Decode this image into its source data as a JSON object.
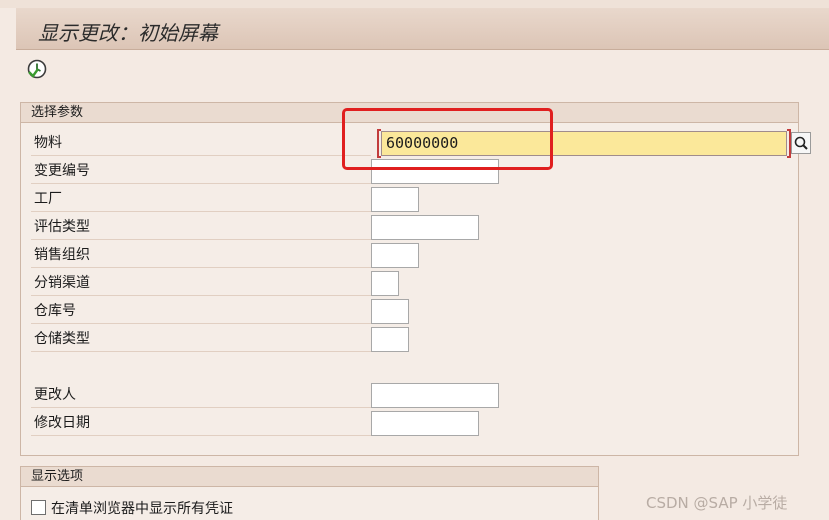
{
  "window": {
    "title": "显示更改：初始屏幕"
  },
  "toolbar": {
    "execute_icon": "execute-clock-icon"
  },
  "selection": {
    "title": "选择参数",
    "fields": [
      {
        "label": "物料",
        "value": "60000000"
      },
      {
        "label": "变更编号",
        "value": ""
      },
      {
        "label": "工厂",
        "value": ""
      },
      {
        "label": "评估类型",
        "value": ""
      },
      {
        "label": "销售组织",
        "value": ""
      },
      {
        "label": "分销渠道",
        "value": ""
      },
      {
        "label": "仓库号",
        "value": ""
      },
      {
        "label": "仓储类型",
        "value": ""
      },
      {
        "label": "更改人",
        "value": ""
      },
      {
        "label": "修改日期",
        "value": ""
      }
    ]
  },
  "display_options": {
    "title": "显示选项",
    "checkbox_label": "在清单浏览器中显示所有凭证",
    "checked": false
  },
  "watermark": "CSDN @SAP 小学徒",
  "colors": {
    "focus_field": "#fbe89a",
    "highlight_box": "#e01f1f"
  }
}
